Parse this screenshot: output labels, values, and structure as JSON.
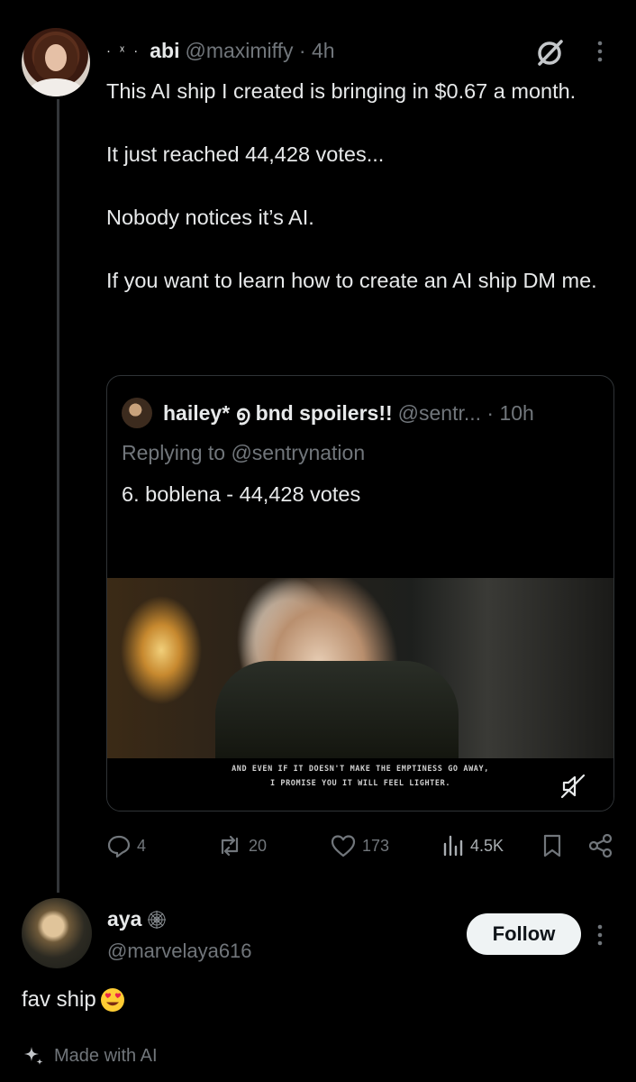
{
  "tweet": {
    "name_prefix": "· ˣ ·",
    "name": "abi",
    "handle_time": "@maximiffy · 4h",
    "paragraphs": [
      "This AI ship I created is bringing in $0.67 a month.",
      "It just reached 44,428 votes...",
      "Nobody notices it’s AI.",
      "If you want to learn how to create an AI ship DM me."
    ]
  },
  "quote": {
    "name": "hailey* ൭ bnd spoilers!!",
    "handle_time": "@sentr... · 10h",
    "replying": "Replying to @sentrynation",
    "text": "6. boblena - 44,428 votes",
    "caption_line1": "AND EVEN IF IT DOESN'T MAKE THE EMPTINESS GO AWAY,",
    "caption_line2": "I PROMISE YOU IT WILL FEEL LIGHTER."
  },
  "actions": {
    "replies": "4",
    "reposts": "20",
    "likes": "173",
    "views": "4.5K"
  },
  "reply": {
    "name": "aya",
    "handle": "@marvelaya616",
    "follow_label": "Follow",
    "text": "fav ship",
    "made_with": "Made with AI"
  },
  "icons": [
    "grok-icon",
    "more-icon",
    "reply-icon",
    "repost-icon",
    "like-icon",
    "views-icon",
    "bookmark-icon",
    "share-icon",
    "mute-icon",
    "spiderweb-icon",
    "heart-eyes-emoji",
    "sparkle-icon"
  ],
  "colors": {
    "background": "#000000",
    "text": "#e7e9ea",
    "secondary": "#71767b",
    "follow_bg": "#eff3f4",
    "border": "#2f3336"
  }
}
